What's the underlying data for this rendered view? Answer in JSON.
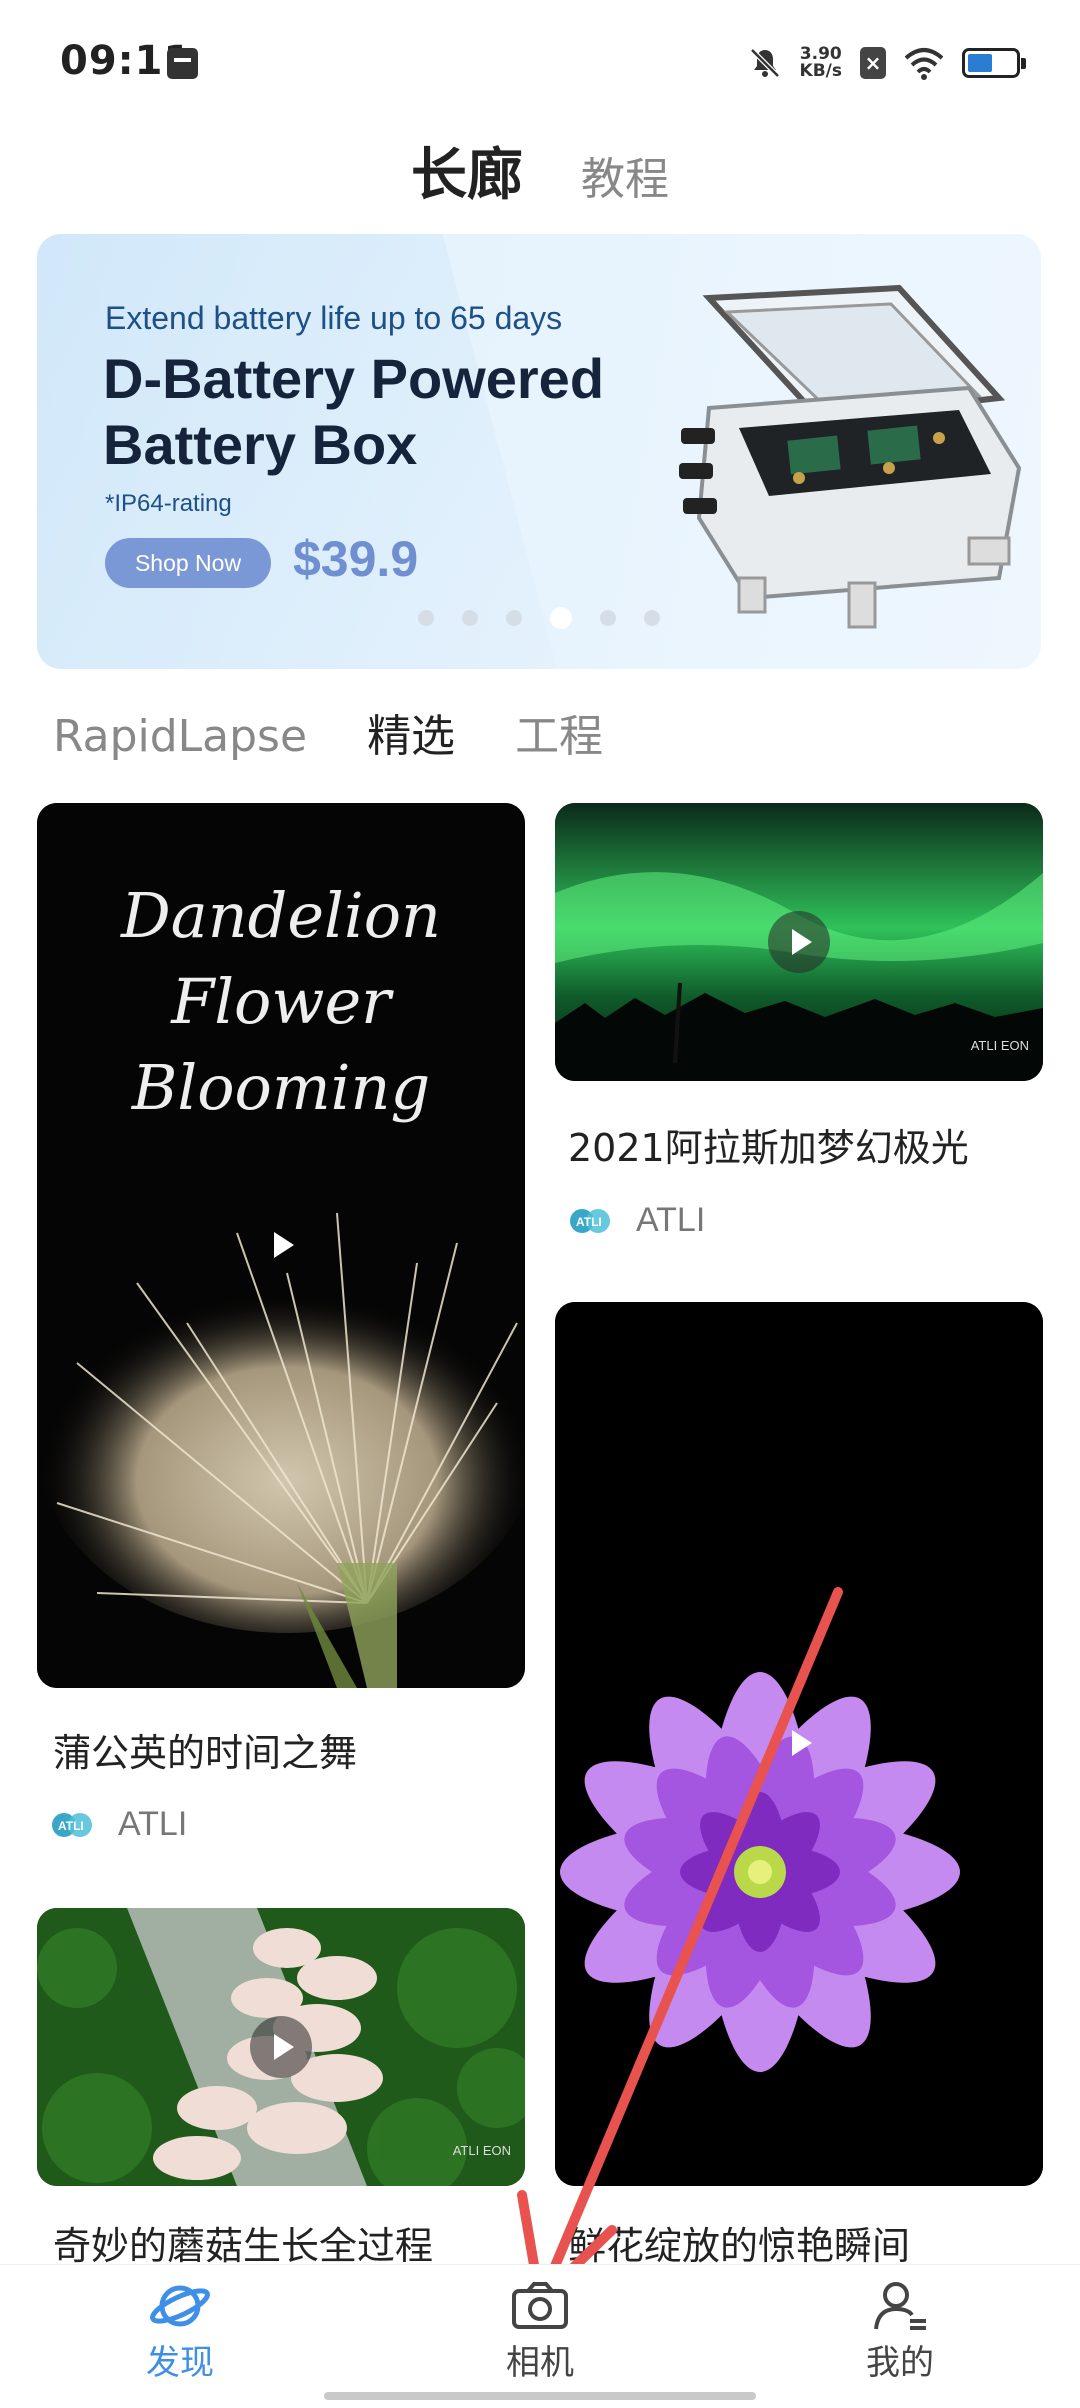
{
  "status_bar": {
    "time": "09:11",
    "net_speed_value": "3.90",
    "net_speed_unit": "KB/s"
  },
  "top_tabs": {
    "active": "长廊",
    "other": "教程"
  },
  "banner": {
    "kicker": "Extend battery life up to 65 days",
    "title": "D-Battery Powered Battery Box",
    "rating": "*IP64-rating",
    "cta": "Shop Now",
    "price": "$39.9",
    "dot_count": 6,
    "active_dot_index": 3
  },
  "sub_tabs": {
    "items": [
      "RapidLapse",
      "精选",
      "工程"
    ],
    "active_index": 1
  },
  "cards": [
    {
      "title": "蒲公英的时间之舞",
      "author": "ATLI",
      "overlay_lines": [
        "Dandelion",
        "Flower",
        "Blooming"
      ]
    },
    {
      "title": "2021阿拉斯加梦幻极光",
      "author": "ATLI",
      "watermark": "ATLI EON"
    },
    {
      "title": "奇妙的蘑菇生长全过程",
      "watermark": "ATLI EON"
    },
    {
      "title": "鲜花绽放的惊艳瞬间"
    }
  ],
  "bottom_nav": {
    "items": [
      "发现",
      "相机",
      "我的"
    ],
    "active_index": 0
  },
  "colors": {
    "accent": "#3f8fe8",
    "annotation_arrow": "#e8524f"
  }
}
